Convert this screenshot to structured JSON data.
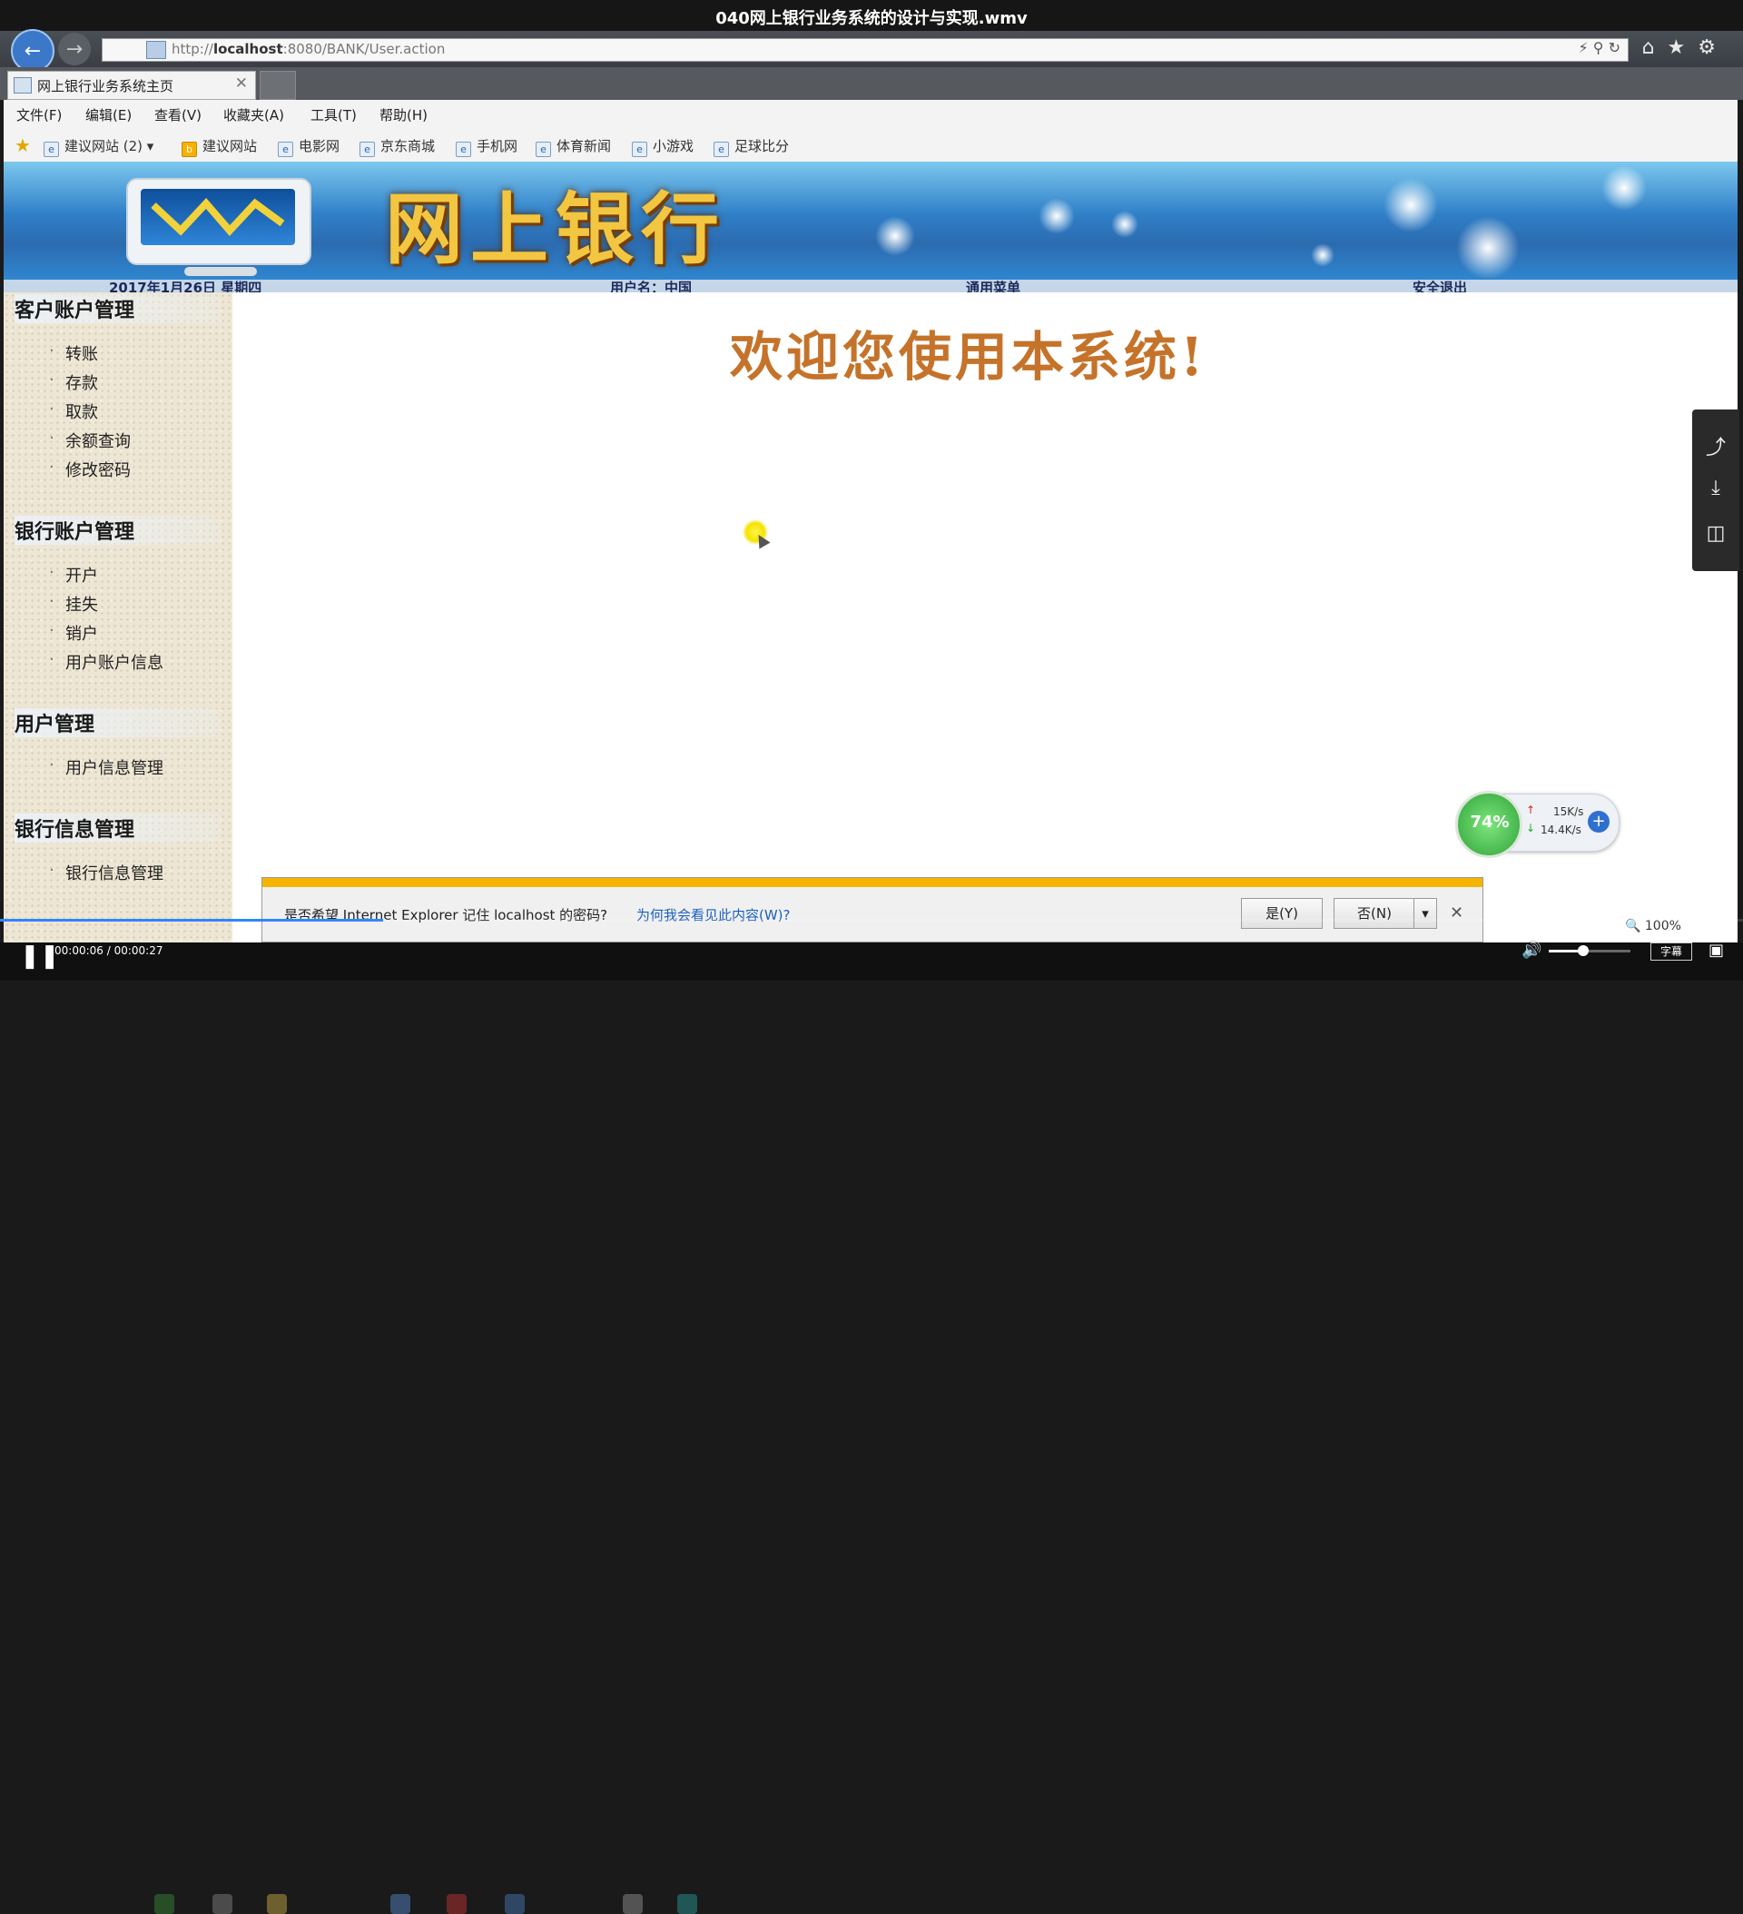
{
  "video": {
    "title": "040网上银行业务系统的设计与实现.wmv",
    "time": "00:00:06 / 00:00:27",
    "progress": 0.22,
    "subtitles_label": "字幕"
  },
  "browser": {
    "url_prefix": "http://",
    "url_host": "localhost",
    "url_rest": ":8080/BANK/User.action",
    "tab_title": "网上银行业务系统主页",
    "menu": [
      "文件(F)",
      "编辑(E)",
      "查看(V)",
      "收藏夹(A)",
      "工具(T)",
      "帮助(H)"
    ],
    "favorites": [
      "建议网站 (2) ▾",
      "建议网站",
      "电影网",
      "京东商城",
      "手机网",
      "体育新闻",
      "小游戏",
      "足球比分"
    ],
    "zoom": "100%"
  },
  "page": {
    "banner_title": "网上银行",
    "info": {
      "date": "2017年1月26日 星期四",
      "user": "用户名：中国",
      "menu": "通用菜单",
      "logout": "安全退出"
    },
    "welcome": "欢迎您使用本系统!",
    "sidebar": [
      {
        "title": "客户账户管理",
        "items": [
          "转账",
          "存款",
          "取款",
          "余额查询",
          "修改密码"
        ]
      },
      {
        "title": "银行账户管理",
        "items": [
          "开户",
          "挂失",
          "销户",
          "用户账户信息"
        ]
      },
      {
        "title": "用户管理",
        "items": [
          "用户信息管理"
        ]
      },
      {
        "title": "银行信息管理",
        "items": [
          "银行信息管理"
        ]
      }
    ]
  },
  "notification": {
    "message": "是否希望 Internet Explorer 记住 localhost 的密码?",
    "link": "为何我会看见此内容(W)?",
    "yes": "是(Y)",
    "no": "否(N)"
  },
  "speed_widget": {
    "percent": "74%",
    "upload": "15K/s",
    "download": "14.4K/s"
  }
}
